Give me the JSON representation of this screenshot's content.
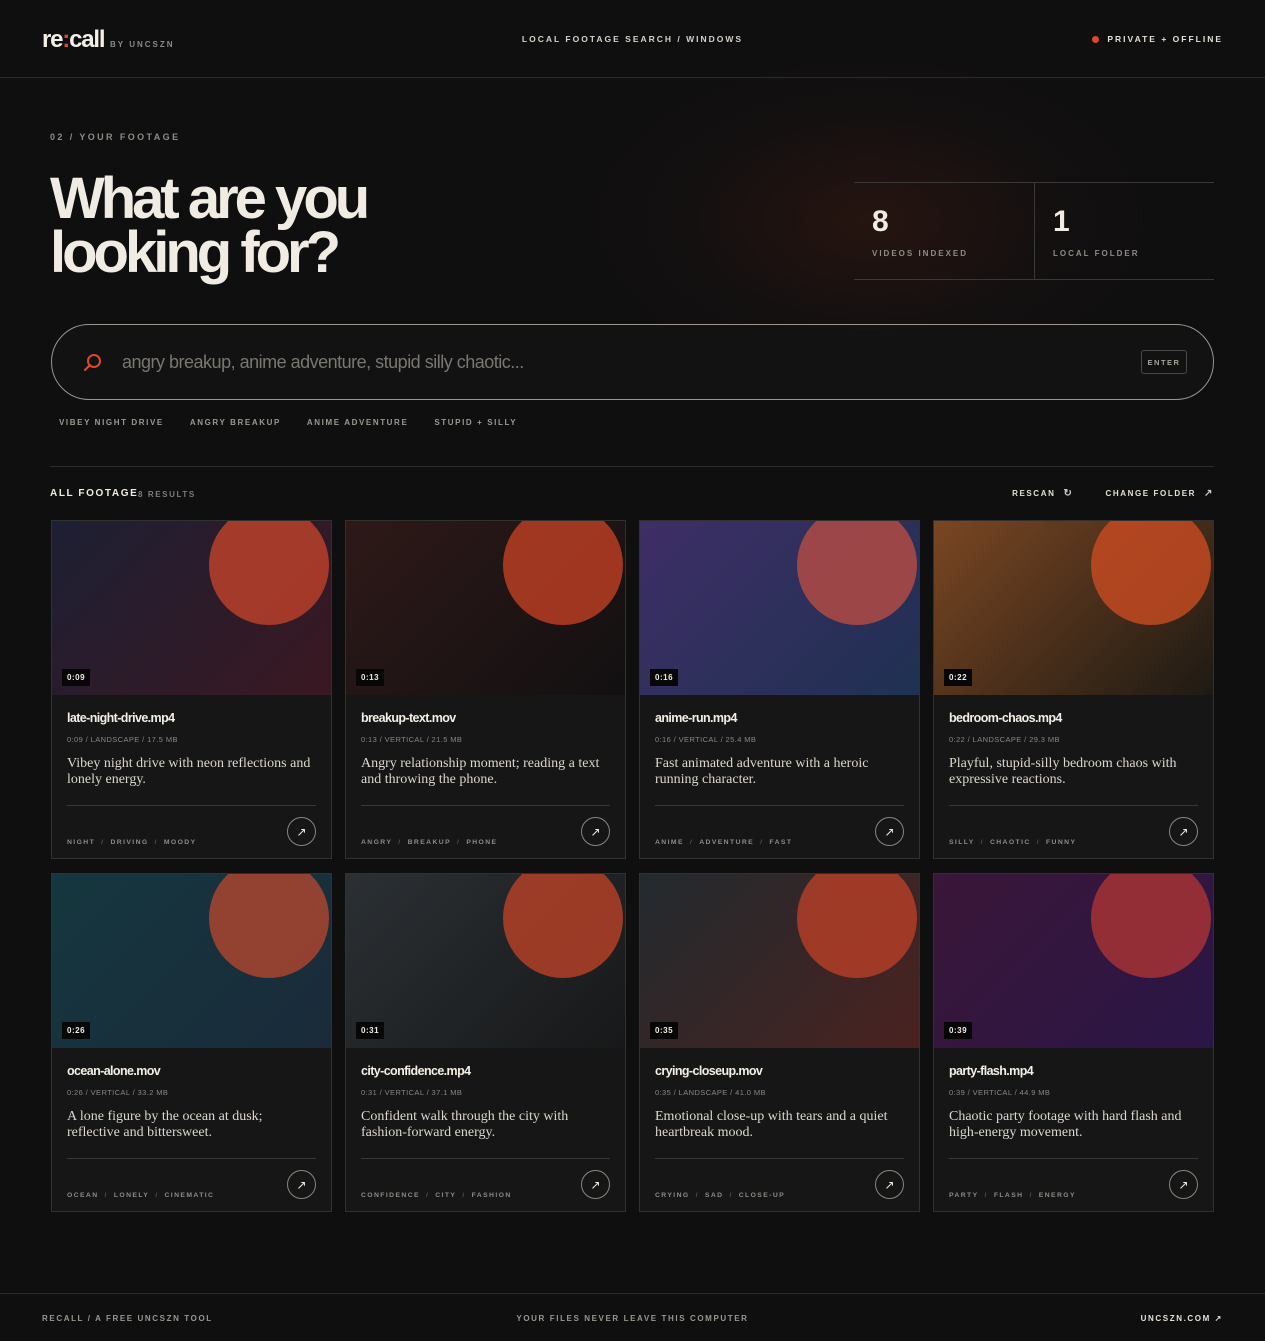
{
  "header": {
    "logo_main": "re",
    "logo_colon": ":",
    "logo_end": "call",
    "byline": "BY UNCSZN",
    "nav": "LOCAL FOOTAGE SEARCH / WINDOWS",
    "status": "PRIVATE + OFFLINE",
    "status_color": "#e0462a"
  },
  "hero": {
    "eyebrow": "02 / YOUR FOOTAGE",
    "headline_line1": "What are you",
    "headline_line2": "looking for?"
  },
  "stats": [
    {
      "value": "8",
      "label": "VIDEOS INDEXED"
    },
    {
      "value": "1",
      "label": "LOCAL FOLDER"
    }
  ],
  "search": {
    "placeholder": "angry breakup, anime adventure, stupid silly chaotic...",
    "enter_label": "ENTER",
    "icon": "search-icon"
  },
  "chips": [
    "VIBEY NIGHT DRIVE",
    "ANGRY BREAKUP",
    "ANIME ADVENTURE",
    "STUPID + SILLY"
  ],
  "results": {
    "title": "ALL FOOTAGE",
    "count": "8 RESULTS",
    "rescan_label": "RESCAN",
    "rescan_icon": "↻",
    "change_folder_label": "CHANGE FOLDER",
    "change_folder_icon": "↗"
  },
  "cards": [
    {
      "duration": "0:09",
      "name": "late-night-drive.mp4",
      "meta": "0:09 / LANDSCAPE / 17.5 MB",
      "description": "Vibey night drive with neon reflections and lonely energy.",
      "tags": [
        "NIGHT",
        "DRIVING",
        "MOODY"
      ],
      "bg1": "#1d1f33",
      "bg2": "#3a1822",
      "sun": "#b8402a"
    },
    {
      "duration": "0:13",
      "name": "breakup-text.mov",
      "meta": "0:13 / VERTICAL / 21.5 MB",
      "description": "Angry relationship moment; reading a text and throwing the phone.",
      "tags": [
        "ANGRY",
        "BREAKUP",
        "PHONE"
      ],
      "bg1": "#2e1918",
      "bg2": "#121011",
      "sun": "#b73d22"
    },
    {
      "duration": "0:16",
      "name": "anime-run.mp4",
      "meta": "0:16 / VERTICAL / 25.4 MB",
      "description": "Fast animated adventure with a heroic running character.",
      "tags": [
        "ANIME",
        "ADVENTURE",
        "FAST"
      ],
      "bg1": "#3e2e66",
      "bg2": "#1f3152",
      "sun": "#b04a45"
    },
    {
      "duration": "0:22",
      "name": "bedroom-chaos.mp4",
      "meta": "0:22 / LANDSCAPE / 29.3 MB",
      "description": "Playful, stupid-silly bedroom chaos with expressive reactions.",
      "tags": [
        "SILLY",
        "CHAOTIC",
        "FUNNY"
      ],
      "bg1": "#7a4622",
      "bg2": "#1e1a14",
      "sun": "#c24a22"
    },
    {
      "duration": "0:26",
      "name": "ocean-alone.mov",
      "meta": "0:26 / VERTICAL / 33.2 MB",
      "description": "A lone figure by the ocean at dusk; reflective and bittersweet.",
      "tags": [
        "OCEAN",
        "LONELY",
        "CINEMATIC"
      ],
      "bg1": "#15373f",
      "bg2": "#1a2a3a",
      "sun": "#a9442f"
    },
    {
      "duration": "0:31",
      "name": "city-confidence.mp4",
      "meta": "0:31 / VERTICAL / 37.1 MB",
      "description": "Confident walk through the city with fashion-forward energy.",
      "tags": [
        "CONFIDENCE",
        "CITY",
        "FASHION"
      ],
      "bg1": "#2b3034",
      "bg2": "#171819",
      "sun": "#b13f27"
    },
    {
      "duration": "0:35",
      "name": "crying-closeup.mov",
      "meta": "0:35 / LANDSCAPE / 41.0 MB",
      "description": "Emotional close-up with tears and a quiet heartbreak mood.",
      "tags": [
        "CRYING",
        "SAD",
        "CLOSE-UP"
      ],
      "bg1": "#222a2e",
      "bg2": "#4a2220",
      "sun": "#b23e28"
    },
    {
      "duration": "0:39",
      "name": "party-flash.mp4",
      "meta": "0:39 / VERTICAL / 44.9 MB",
      "description": "Chaotic party footage with hard flash and high-energy movement.",
      "tags": [
        "PARTY",
        "FLASH",
        "ENERGY"
      ],
      "bg1": "#3a1638",
      "bg2": "#2a1646",
      "sun": "#a53236"
    }
  ],
  "card_action_icon": "↗",
  "footer": {
    "left": "RECALL / A FREE UNCSZN TOOL",
    "center": "YOUR FILES NEVER LEAVE THIS COMPUTER",
    "right": "UNCSZN.COM ↗"
  }
}
